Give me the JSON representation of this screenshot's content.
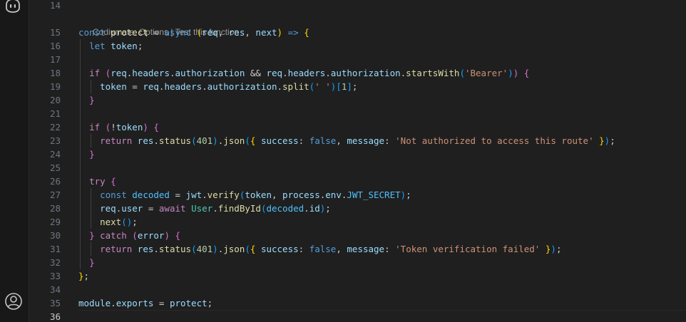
{
  "editor": {
    "code_lens": {
      "line": 15,
      "options_label": "Codiumate: Options",
      "separator": " | ",
      "test_label": "Test this function"
    },
    "current_line": 36,
    "lines": [
      {
        "n": "14",
        "tokens": []
      },
      {
        "n": "15",
        "tokens": [
          {
            "t": "const",
            "c": "kw"
          },
          {
            "t": " "
          },
          {
            "t": "protect",
            "c": "fn"
          },
          {
            "t": " = "
          },
          {
            "t": "async",
            "c": "kw"
          },
          {
            "t": " "
          },
          {
            "t": "(",
            "c": "b1"
          },
          {
            "t": "req",
            "c": "var"
          },
          {
            "t": ", "
          },
          {
            "t": "res",
            "c": "var"
          },
          {
            "t": ", "
          },
          {
            "t": "next",
            "c": "var"
          },
          {
            "t": ")",
            "c": "b1"
          },
          {
            "t": " "
          },
          {
            "t": "=>",
            "c": "kw"
          },
          {
            "t": " "
          },
          {
            "t": "{",
            "c": "b1"
          }
        ]
      },
      {
        "n": "16",
        "tokens": [
          {
            "t": "  "
          },
          {
            "t": "let",
            "c": "kw"
          },
          {
            "t": " "
          },
          {
            "t": "token",
            "c": "var"
          },
          {
            "t": ";"
          }
        ]
      },
      {
        "n": "17",
        "tokens": []
      },
      {
        "n": "18",
        "tokens": [
          {
            "t": "  "
          },
          {
            "t": "if",
            "c": "ctl"
          },
          {
            "t": " "
          },
          {
            "t": "(",
            "c": "b2"
          },
          {
            "t": "req",
            "c": "var"
          },
          {
            "t": "."
          },
          {
            "t": "headers",
            "c": "var"
          },
          {
            "t": "."
          },
          {
            "t": "authorization",
            "c": "var"
          },
          {
            "t": " && "
          },
          {
            "t": "req",
            "c": "var"
          },
          {
            "t": "."
          },
          {
            "t": "headers",
            "c": "var"
          },
          {
            "t": "."
          },
          {
            "t": "authorization",
            "c": "var"
          },
          {
            "t": "."
          },
          {
            "t": "startsWith",
            "c": "fn"
          },
          {
            "t": "(",
            "c": "b3"
          },
          {
            "t": "'Bearer'",
            "c": "str"
          },
          {
            "t": ")",
            "c": "b3"
          },
          {
            "t": ")",
            "c": "b2"
          },
          {
            "t": " "
          },
          {
            "t": "{",
            "c": "b2"
          }
        ]
      },
      {
        "n": "19",
        "tokens": [
          {
            "t": "    "
          },
          {
            "t": "token",
            "c": "var"
          },
          {
            "t": " = "
          },
          {
            "t": "req",
            "c": "var"
          },
          {
            "t": "."
          },
          {
            "t": "headers",
            "c": "var"
          },
          {
            "t": "."
          },
          {
            "t": "authorization",
            "c": "var"
          },
          {
            "t": "."
          },
          {
            "t": "split",
            "c": "fn"
          },
          {
            "t": "(",
            "c": "b3"
          },
          {
            "t": "' '",
            "c": "str"
          },
          {
            "t": ")",
            "c": "b3"
          },
          {
            "t": "[",
            "c": "b3"
          },
          {
            "t": "1",
            "c": "num"
          },
          {
            "t": "]",
            "c": "b3"
          },
          {
            "t": ";"
          }
        ]
      },
      {
        "n": "20",
        "tokens": [
          {
            "t": "  "
          },
          {
            "t": "}",
            "c": "b2"
          }
        ]
      },
      {
        "n": "21",
        "tokens": []
      },
      {
        "n": "22",
        "tokens": [
          {
            "t": "  "
          },
          {
            "t": "if",
            "c": "ctl"
          },
          {
            "t": " "
          },
          {
            "t": "(",
            "c": "b2"
          },
          {
            "t": "!"
          },
          {
            "t": "token",
            "c": "var"
          },
          {
            "t": ")",
            "c": "b2"
          },
          {
            "t": " "
          },
          {
            "t": "{",
            "c": "b2"
          }
        ]
      },
      {
        "n": "23",
        "tokens": [
          {
            "t": "    "
          },
          {
            "t": "return",
            "c": "ctl"
          },
          {
            "t": " "
          },
          {
            "t": "res",
            "c": "var"
          },
          {
            "t": "."
          },
          {
            "t": "status",
            "c": "fn"
          },
          {
            "t": "(",
            "c": "b3"
          },
          {
            "t": "401",
            "c": "num"
          },
          {
            "t": ")",
            "c": "b3"
          },
          {
            "t": "."
          },
          {
            "t": "json",
            "c": "fn"
          },
          {
            "t": "(",
            "c": "b3"
          },
          {
            "t": "{",
            "c": "b1"
          },
          {
            "t": " "
          },
          {
            "t": "success",
            "c": "var"
          },
          {
            "t": ": "
          },
          {
            "t": "false",
            "c": "kw"
          },
          {
            "t": ", "
          },
          {
            "t": "message",
            "c": "var"
          },
          {
            "t": ": "
          },
          {
            "t": "'Not authorized to access this route'",
            "c": "str"
          },
          {
            "t": " "
          },
          {
            "t": "}",
            "c": "b1"
          },
          {
            "t": ")",
            "c": "b3"
          },
          {
            "t": ";"
          }
        ]
      },
      {
        "n": "24",
        "tokens": [
          {
            "t": "  "
          },
          {
            "t": "}",
            "c": "b2"
          }
        ]
      },
      {
        "n": "25",
        "tokens": []
      },
      {
        "n": "26",
        "tokens": [
          {
            "t": "  "
          },
          {
            "t": "try",
            "c": "ctl"
          },
          {
            "t": " "
          },
          {
            "t": "{",
            "c": "b2"
          }
        ]
      },
      {
        "n": "27",
        "tokens": [
          {
            "t": "    "
          },
          {
            "t": "const",
            "c": "kw"
          },
          {
            "t": " "
          },
          {
            "t": "decoded",
            "c": "cst"
          },
          {
            "t": " = "
          },
          {
            "t": "jwt",
            "c": "var"
          },
          {
            "t": "."
          },
          {
            "t": "verify",
            "c": "fn"
          },
          {
            "t": "(",
            "c": "b3"
          },
          {
            "t": "token",
            "c": "var"
          },
          {
            "t": ", "
          },
          {
            "t": "process",
            "c": "var"
          },
          {
            "t": "."
          },
          {
            "t": "env",
            "c": "var"
          },
          {
            "t": "."
          },
          {
            "t": "JWT_SECRET",
            "c": "cst"
          },
          {
            "t": ")",
            "c": "b3"
          },
          {
            "t": ";"
          }
        ]
      },
      {
        "n": "28",
        "tokens": [
          {
            "t": "    "
          },
          {
            "t": "req",
            "c": "var"
          },
          {
            "t": "."
          },
          {
            "t": "user",
            "c": "var"
          },
          {
            "t": " = "
          },
          {
            "t": "await",
            "c": "ctl"
          },
          {
            "t": " "
          },
          {
            "t": "User",
            "c": "cls"
          },
          {
            "t": "."
          },
          {
            "t": "findById",
            "c": "fn"
          },
          {
            "t": "(",
            "c": "b3"
          },
          {
            "t": "decoded",
            "c": "cst"
          },
          {
            "t": "."
          },
          {
            "t": "id",
            "c": "var"
          },
          {
            "t": ")",
            "c": "b3"
          },
          {
            "t": ";"
          }
        ]
      },
      {
        "n": "29",
        "tokens": [
          {
            "t": "    "
          },
          {
            "t": "next",
            "c": "fn"
          },
          {
            "t": "(",
            "c": "b3"
          },
          {
            "t": ")",
            "c": "b3"
          },
          {
            "t": ";"
          }
        ]
      },
      {
        "n": "30",
        "tokens": [
          {
            "t": "  "
          },
          {
            "t": "}",
            "c": "b2"
          },
          {
            "t": " "
          },
          {
            "t": "catch",
            "c": "ctl"
          },
          {
            "t": " "
          },
          {
            "t": "(",
            "c": "b2"
          },
          {
            "t": "error",
            "c": "var"
          },
          {
            "t": ")",
            "c": "b2"
          },
          {
            "t": " "
          },
          {
            "t": "{",
            "c": "b2"
          }
        ]
      },
      {
        "n": "31",
        "tokens": [
          {
            "t": "    "
          },
          {
            "t": "return",
            "c": "ctl"
          },
          {
            "t": " "
          },
          {
            "t": "res",
            "c": "var"
          },
          {
            "t": "."
          },
          {
            "t": "status",
            "c": "fn"
          },
          {
            "t": "(",
            "c": "b3"
          },
          {
            "t": "401",
            "c": "num"
          },
          {
            "t": ")",
            "c": "b3"
          },
          {
            "t": "."
          },
          {
            "t": "json",
            "c": "fn"
          },
          {
            "t": "(",
            "c": "b3"
          },
          {
            "t": "{",
            "c": "b1"
          },
          {
            "t": " "
          },
          {
            "t": "success",
            "c": "var"
          },
          {
            "t": ": "
          },
          {
            "t": "false",
            "c": "kw"
          },
          {
            "t": ", "
          },
          {
            "t": "message",
            "c": "var"
          },
          {
            "t": ": "
          },
          {
            "t": "'Token verification failed'",
            "c": "str"
          },
          {
            "t": " "
          },
          {
            "t": "}",
            "c": "b1"
          },
          {
            "t": ")",
            "c": "b3"
          },
          {
            "t": ";"
          }
        ]
      },
      {
        "n": "32",
        "tokens": [
          {
            "t": "  "
          },
          {
            "t": "}",
            "c": "b2"
          }
        ]
      },
      {
        "n": "33",
        "tokens": [
          {
            "t": "}",
            "c": "b1"
          },
          {
            "t": ";"
          }
        ]
      },
      {
        "n": "34",
        "tokens": []
      },
      {
        "n": "35",
        "tokens": [
          {
            "t": "module",
            "c": "var"
          },
          {
            "t": "."
          },
          {
            "t": "exports",
            "c": "var"
          },
          {
            "t": " = "
          },
          {
            "t": "protect",
            "c": "var"
          },
          {
            "t": ";"
          }
        ]
      },
      {
        "n": "36",
        "tokens": []
      }
    ]
  },
  "activity_bar": {
    "top_icon": "copilot-icon",
    "bottom_icon": "account-icon"
  },
  "colors": {
    "keyword": "#569cd6",
    "control": "#c586c0",
    "variable": "#9cdcfe",
    "function": "#dcdcaa",
    "string": "#ce9178",
    "number": "#b5cea8",
    "class": "#4ec9b0",
    "constant": "#4fc1ff",
    "bracket_1": "#ffd700",
    "bracket_2": "#da70d6",
    "bracket_3": "#179fff"
  }
}
